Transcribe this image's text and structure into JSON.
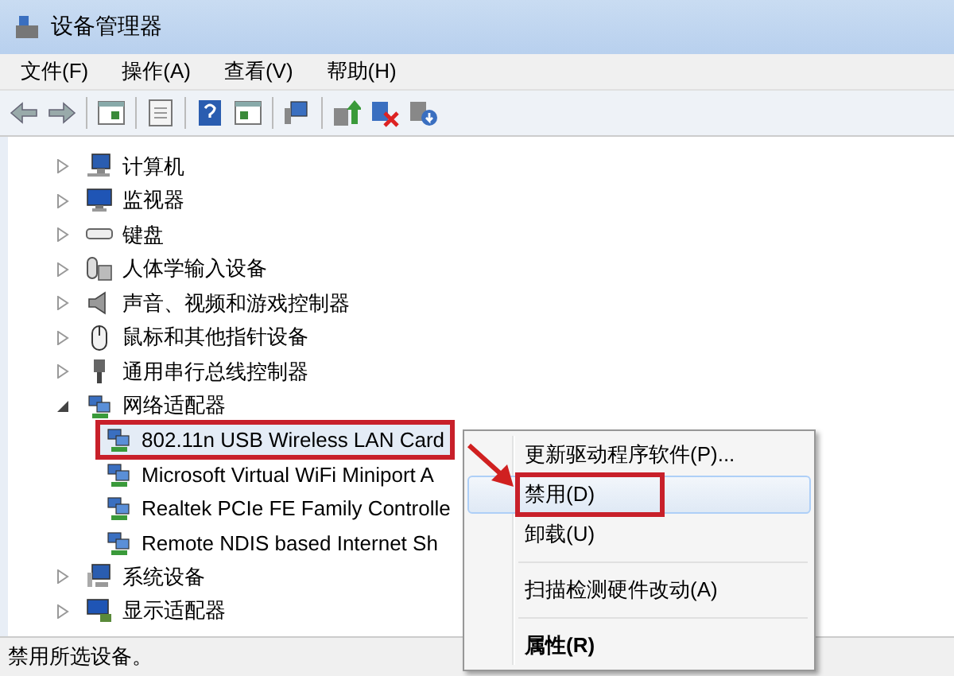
{
  "window": {
    "title": "设备管理器"
  },
  "menu_bar": [
    {
      "label": "文件(F)"
    },
    {
      "label": "操作(A)"
    },
    {
      "label": "查看(V)"
    },
    {
      "label": "帮助(H)"
    }
  ],
  "tree": [
    {
      "kind": "computer",
      "label": "计算机",
      "expanded": false
    },
    {
      "kind": "monitor",
      "label": "监视器",
      "expanded": false
    },
    {
      "kind": "keyboard",
      "label": "键盘",
      "expanded": false
    },
    {
      "kind": "hid",
      "label": "人体学输入设备",
      "expanded": false
    },
    {
      "kind": "sound",
      "label": "声音、视频和游戏控制器",
      "expanded": false
    },
    {
      "kind": "mouse",
      "label": "鼠标和其他指针设备",
      "expanded": false
    },
    {
      "kind": "usb",
      "label": "通用串行总线控制器",
      "expanded": false
    },
    {
      "kind": "network",
      "label": "网络适配器",
      "expanded": true,
      "children": [
        {
          "label": "802.11n USB Wireless LAN Card",
          "selected": true,
          "annotated": true
        },
        {
          "label": "Microsoft Virtual WiFi Miniport A",
          "selected": false,
          "annotated": false
        },
        {
          "label": "Realtek PCIe FE Family Controlle",
          "selected": false,
          "annotated": false
        },
        {
          "label": "Remote NDIS based Internet Sh",
          "selected": false,
          "annotated": false
        }
      ]
    },
    {
      "kind": "system",
      "label": "系统设备",
      "expanded": false
    },
    {
      "kind": "display",
      "label": "显示适配器",
      "expanded": false
    }
  ],
  "context_menu": [
    {
      "kind": "item",
      "label": "更新驱动程序软件(P)...",
      "selected": false,
      "default": false,
      "annotated": false
    },
    {
      "kind": "item",
      "label": "禁用(D)",
      "selected": true,
      "default": false,
      "annotated": true
    },
    {
      "kind": "item",
      "label": "卸载(U)",
      "selected": false,
      "default": false,
      "annotated": false
    },
    {
      "kind": "separator"
    },
    {
      "kind": "item",
      "label": "扫描检测硬件改动(A)",
      "selected": false,
      "default": false,
      "annotated": false
    },
    {
      "kind": "separator"
    },
    {
      "kind": "item",
      "label": "属性(R)",
      "selected": false,
      "default": true,
      "annotated": false
    }
  ],
  "status_bar": {
    "text": "禁用所选设备。"
  }
}
